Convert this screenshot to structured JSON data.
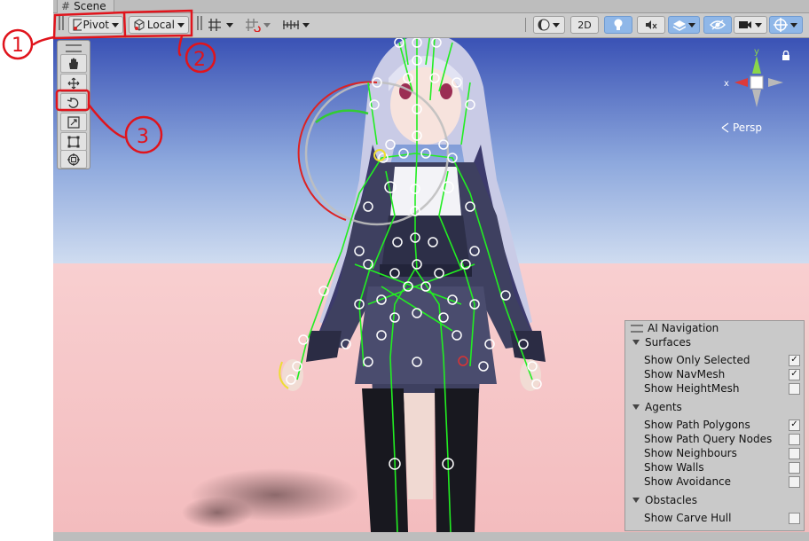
{
  "window": {
    "tab_title": "Scene"
  },
  "toolbar": {
    "pivot_label": "Pivot",
    "local_label": "Local",
    "mode_2d_label": "2D"
  },
  "gizmo": {
    "x_label": "x",
    "y_label": "y",
    "persp_label": "Persp"
  },
  "tools": [
    {
      "name": "hand-tool",
      "icon": "hand-icon"
    },
    {
      "name": "move-tool",
      "icon": "move-arrows-icon"
    },
    {
      "name": "rotate-tool",
      "icon": "rotate-icon",
      "selected": true
    },
    {
      "name": "scale-tool",
      "icon": "scale-icon"
    },
    {
      "name": "rect-tool",
      "icon": "rect-transform-icon"
    },
    {
      "name": "transform-tool",
      "icon": "transform-icon"
    }
  ],
  "ai_navigation": {
    "title": "AI Navigation",
    "sections": [
      {
        "name": "Surfaces",
        "items": [
          {
            "label": "Show Only Selected",
            "checked": true
          },
          {
            "label": "Show NavMesh",
            "checked": true
          },
          {
            "label": "Show HeightMesh",
            "checked": false
          }
        ]
      },
      {
        "name": "Agents",
        "items": [
          {
            "label": "Show Path Polygons",
            "checked": true
          },
          {
            "label": "Show Path Query Nodes",
            "checked": false
          },
          {
            "label": "Show Neighbours",
            "checked": false
          },
          {
            "label": "Show Walls",
            "checked": false
          },
          {
            "label": "Show Avoidance",
            "checked": false
          }
        ]
      },
      {
        "name": "Obstacles",
        "items": [
          {
            "label": "Show Carve Hull",
            "checked": false
          }
        ]
      }
    ]
  },
  "annotations": [
    "1",
    "2",
    "3"
  ],
  "colors": {
    "annotation_red": "#e0141c",
    "bone_green": "#22ee22",
    "sky_top": "#3d55b8",
    "floor": "#f5c4c6"
  }
}
